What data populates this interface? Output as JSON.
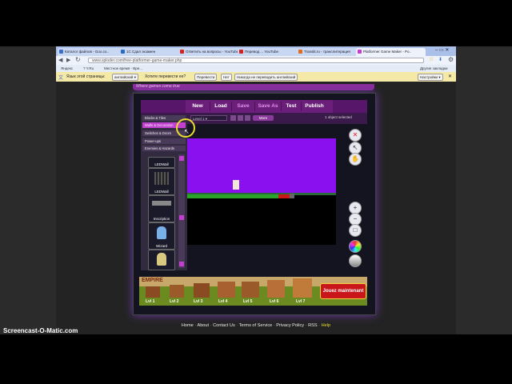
{
  "browser": {
    "tabs": [
      {
        "label": "Каталог файлов - Goo.co..",
        "color": "#3a70c8"
      },
      {
        "label": "1С Сдал экзамен",
        "color": "#2a6cc2"
      },
      {
        "label": "Ответить на вопросы - YouTube",
        "color": "#d22222"
      },
      {
        "label": "Перевод ... YouTube",
        "color": "#d22222"
      },
      {
        "label": "Translit.ru - транслитерация",
        "color": "#e06a20"
      },
      {
        "label": "Platformer Game Maker - Po..",
        "color": "#c83acd",
        "active": true
      }
    ],
    "url": "www.sploder.com/free-platformer-game-maker.php",
    "bookmarks": [
      "Яндекс",
      "? Y.Ru",
      "Местное время - Вре..."
    ],
    "other_bookmarks": "Другие закладки",
    "translate_bar": {
      "lang_label": "Язык этой страницы:",
      "lang_value": "английский",
      "question": "Хотите перевести ее?",
      "translate_btn": "Перевести",
      "no_btn": "Нет",
      "never_btn": "Никогда не переводить английский",
      "settings_btn": "Настройки"
    },
    "page_tagline": "Where games come true"
  },
  "gamemaker": {
    "toolbar": {
      "new": "New",
      "load": "Load",
      "save": "Save",
      "save_as": "Save As",
      "test": "Test",
      "publish": "Publish"
    },
    "level_select": "Level 1",
    "more": "More",
    "status": "1 object selected",
    "categories": [
      {
        "label": "Blocks & Tiles",
        "selected": false
      },
      {
        "label": "Walls & Decoration",
        "selected": true
      },
      {
        "label": "Switches & Doors",
        "selected": false
      },
      {
        "label": "Power-ups",
        "selected": false
      },
      {
        "label": "Enemies & Hazards",
        "selected": false
      }
    ],
    "palette_items": [
      "LEDWall",
      "LEDWall",
      "Inscription",
      "Wizard",
      ""
    ]
  },
  "ad": {
    "brand": "EMPIRE",
    "levels": [
      "Lvl 1",
      "Lvl 2",
      "Lvl 3",
      "Lvl 4",
      "Lvl 5",
      "Lvl 6",
      "Lvl 7"
    ],
    "cta": "Jouez maintenant"
  },
  "footer": {
    "links": [
      "Home",
      "About",
      "Contact Us",
      "Terms of Service",
      "Privacy Policy",
      "RSS",
      "Help"
    ]
  },
  "watermark": "Screencast-O-Matic.com",
  "colors": {
    "toolbar": "#6b1e7a",
    "sky": "#8a10f0",
    "grass": "#2aa52a",
    "highlight": "#c23fcf",
    "cursor_ring": "#e9de2d"
  }
}
